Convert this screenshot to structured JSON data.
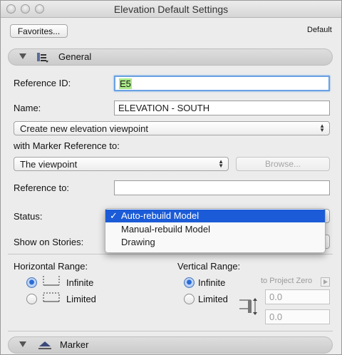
{
  "window": {
    "title": "Elevation Default Settings"
  },
  "toolbar": {
    "favorites_label": "Favorites...",
    "default_label": "Default"
  },
  "general": {
    "section_label": "General",
    "reference_id_label": "Reference ID:",
    "reference_id_value": "E5",
    "name_label": "Name:",
    "name_value": "ELEVATION - SOUTH",
    "viewpoint_select": "Create new elevation viewpoint",
    "marker_ref_label": "with Marker Reference to:",
    "marker_ref_select": "The viewpoint",
    "browse_label": "Browse...",
    "reference_to_label": "Reference to:",
    "reference_to_value": "",
    "status_label": "Status:",
    "status_options": [
      "Auto-rebuild Model",
      "Manual-rebuild Model",
      "Drawing"
    ],
    "status_selected": "Auto-rebuild Model",
    "stories_label": "Show on Stories:",
    "check_mark": "✓"
  },
  "ranges": {
    "horizontal_label": "Horizontal Range:",
    "horizontal_options": [
      "Infinite",
      "Limited"
    ],
    "horizontal_selected": "Infinite",
    "vertical_label": "Vertical Range:",
    "vertical_options": [
      "Infinite",
      "Limited"
    ],
    "vertical_selected": "Infinite",
    "project_zero_label": "to Project Zero",
    "vertical_top": "0.0",
    "vertical_bottom": "0.0"
  },
  "marker": {
    "section_label": "Marker"
  }
}
